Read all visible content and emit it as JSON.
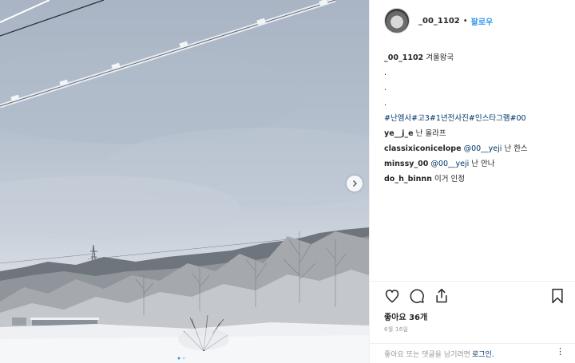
{
  "post": {
    "username": "_00_1102",
    "separator": "•",
    "follow_label": "팔로우",
    "caption": {
      "username": "_00_1102",
      "text": "겨울왕국",
      "dots": [
        ".",
        ".",
        "."
      ],
      "hashtags": "#난엠사#고3#1년전사진#인스타그램#00"
    },
    "comments": [
      {
        "username": "ye__j_e",
        "pre": "",
        "mention": "",
        "text": "난 올라프"
      },
      {
        "username": "classixiconicelope",
        "pre": "",
        "mention": "@00__yeji",
        "text": "난 한스"
      },
      {
        "username": "minssy_00",
        "pre": "",
        "mention": "@00__yeji",
        "text": "난 안나"
      },
      {
        "username": "do_h_binnn",
        "pre": "",
        "mention": "",
        "text": "이거 인정"
      }
    ],
    "likes": "좋아요 36개",
    "date": "6월 16일",
    "login_prompt": "좋아요 또는 댓글을 남기려면",
    "login_link": "로그인.",
    "more_label": "⋮"
  },
  "icons": {
    "like": "heart-icon",
    "comment": "comment-icon",
    "share": "share-icon",
    "save": "bookmark-icon",
    "next": "chevron-right-icon"
  },
  "colors": {
    "link": "#003569",
    "follow": "#3897f0",
    "muted": "#999999"
  }
}
